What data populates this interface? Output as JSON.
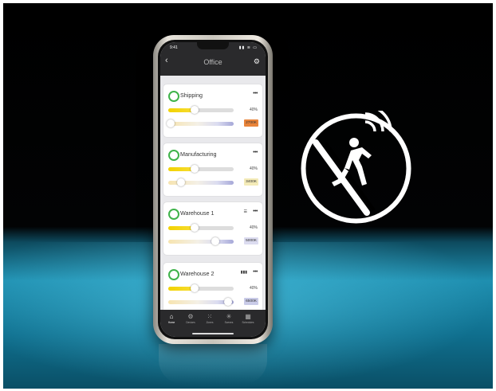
{
  "phone": {
    "status_time": "9:41",
    "status_icons": "▮▮ ≋ ▭",
    "header": {
      "back_glyph": "‹",
      "title": "Office",
      "settings_glyph": "⚙"
    },
    "cards": [
      {
        "name": "Shipping",
        "extra_glyph": "",
        "more_glyph": "•••",
        "brightness_label": "40%",
        "brightness_value": 0.4,
        "cct_label": "2700K",
        "cct_value": 0.0,
        "badge_color": "#e9843a"
      },
      {
        "name": "Manufacturing",
        "extra_glyph": "",
        "more_glyph": "•••",
        "brightness_label": "40%",
        "brightness_value": 0.4,
        "cct_label": "3400K",
        "cct_value": 0.2,
        "badge_color": "#f4ebb8"
      },
      {
        "name": "Warehouse 1",
        "extra_glyph": "☰",
        "more_glyph": "•••",
        "brightness_label": "40%",
        "brightness_value": 0.4,
        "cct_label": "5000K",
        "cct_value": 0.72,
        "badge_color": "#dcdcf0"
      },
      {
        "name": "Warehouse 2",
        "extra_glyph": "▮▮▮",
        "more_glyph": "•••",
        "brightness_label": "40%",
        "brightness_value": 0.4,
        "cct_label": "6500K",
        "cct_value": 0.92,
        "badge_color": "#c9cbe8"
      }
    ],
    "tabs": [
      {
        "label": "Home",
        "icon": "⌂"
      },
      {
        "label": "Devices",
        "icon": "⚙"
      },
      {
        "label": "Zones",
        "icon": "⁙"
      },
      {
        "label": "Scenes",
        "icon": "✳"
      },
      {
        "label": "Schedules",
        "icon": "▦"
      }
    ]
  },
  "sensor_icon": "motion-sensor-icon",
  "colors": {
    "accent_green": "#3fb34a",
    "brightness_yellow": "#f2d200"
  }
}
